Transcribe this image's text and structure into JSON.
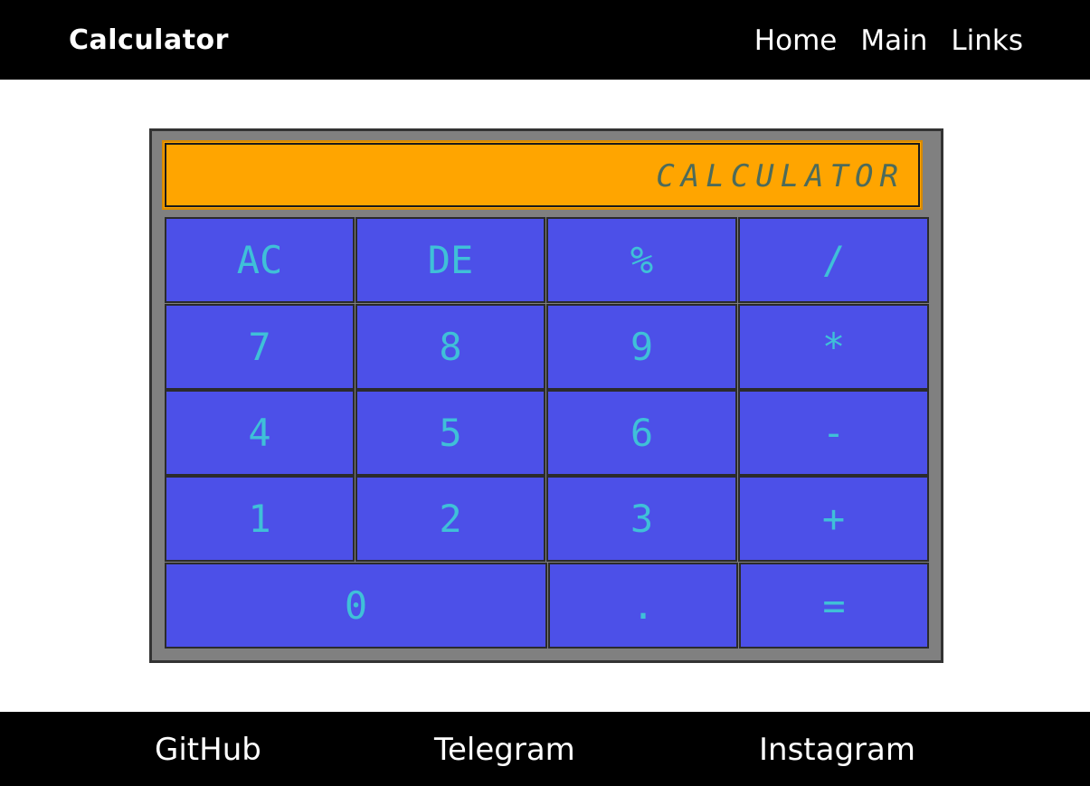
{
  "header": {
    "brand": "Calculator",
    "nav": [
      "Home",
      "Main",
      "Links"
    ]
  },
  "calculator": {
    "display": "CALCULATOR",
    "keys": [
      {
        "label": "AC",
        "name": "clear-all-button"
      },
      {
        "label": "DE",
        "name": "delete-button"
      },
      {
        "label": "%",
        "name": "percent-button"
      },
      {
        "label": "/",
        "name": "divide-button"
      },
      {
        "label": "7",
        "name": "digit-7-button"
      },
      {
        "label": "8",
        "name": "digit-8-button"
      },
      {
        "label": "9",
        "name": "digit-9-button"
      },
      {
        "label": "*",
        "name": "multiply-button"
      },
      {
        "label": "4",
        "name": "digit-4-button"
      },
      {
        "label": "5",
        "name": "digit-5-button"
      },
      {
        "label": "6",
        "name": "digit-6-button"
      },
      {
        "label": "-",
        "name": "subtract-button"
      },
      {
        "label": "1",
        "name": "digit-1-button"
      },
      {
        "label": "2",
        "name": "digit-2-button"
      },
      {
        "label": "3",
        "name": "digit-3-button"
      },
      {
        "label": "+",
        "name": "add-button"
      },
      {
        "label": "0",
        "name": "digit-0-button"
      },
      {
        "label": ".",
        "name": "decimal-button"
      },
      {
        "label": "=",
        "name": "equals-button"
      }
    ]
  },
  "footer": {
    "links": [
      "GitHub",
      "Telegram",
      "Instagram"
    ]
  },
  "colors": {
    "bar": "#000000",
    "display": "#ffa500",
    "key": "#4c50e8",
    "key_text": "#3fc0d8",
    "frame": "#808080"
  }
}
